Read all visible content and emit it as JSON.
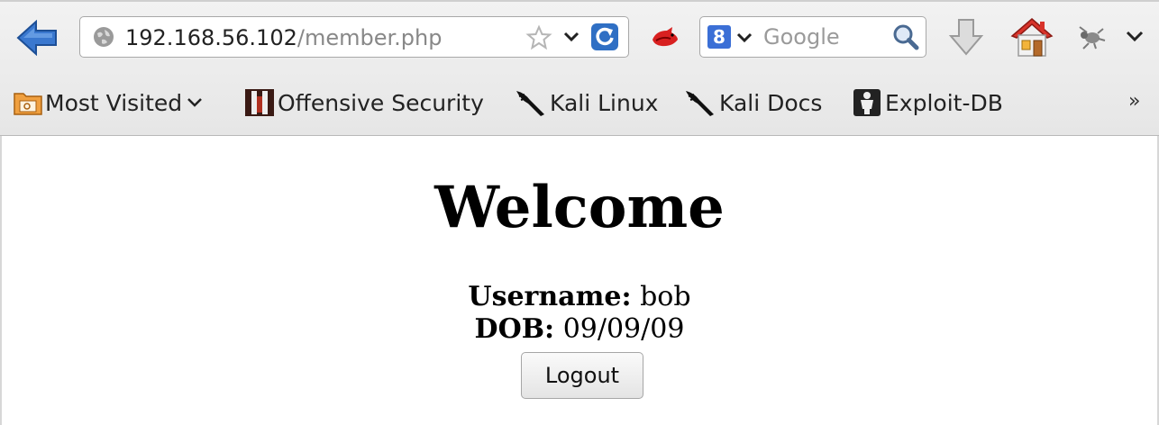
{
  "browser": {
    "url_host": "192.168.56.102",
    "url_path": "/member.php",
    "search_engine_placeholder": "Google"
  },
  "bookmarks": [
    {
      "label": "Most Visited"
    },
    {
      "label": "Offensive Security"
    },
    {
      "label": "Kali Linux"
    },
    {
      "label": "Kali Docs"
    },
    {
      "label": "Exploit-DB"
    }
  ],
  "bookmarks_overflow": "»",
  "page": {
    "heading": "Welcome",
    "username_label": "Username:",
    "username_value": "bob",
    "dob_label": "DOB:",
    "dob_value": "09/09/09",
    "logout_label": "Logout"
  },
  "colors": {
    "back_arrow": "#2f6fc4",
    "google_blue": "#3b6fd6",
    "home_roof": "#d8332a"
  }
}
